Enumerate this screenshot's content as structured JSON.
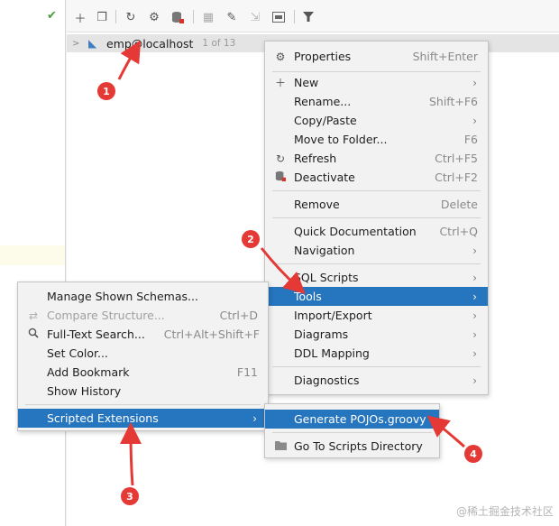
{
  "toolbar": {
    "icons": [
      "add-icon",
      "duplicate-icon",
      "refresh-icon",
      "properties-icon",
      "deactivate-icon",
      "table-icon",
      "edit-icon",
      "jump-icon",
      "query-console-icon",
      "filter-icon"
    ]
  },
  "tree": {
    "connection_label": "emp@localhost",
    "count_label": "1 of 13"
  },
  "context_menu": {
    "items": [
      {
        "label": "Properties",
        "shortcut": "Shift+Enter"
      },
      {
        "label": "New"
      },
      {
        "label": "Rename...",
        "shortcut": "Shift+F6"
      },
      {
        "label": "Copy/Paste"
      },
      {
        "label": "Move to Folder...",
        "shortcut": "F6"
      },
      {
        "label": "Refresh",
        "shortcut": "Ctrl+F5"
      },
      {
        "label": "Deactivate",
        "shortcut": "Ctrl+F2"
      },
      {
        "label": "Remove",
        "shortcut": "Delete"
      },
      {
        "label": "Quick Documentation",
        "shortcut": "Ctrl+Q"
      },
      {
        "label": "Navigation"
      },
      {
        "label": "SQL Scripts"
      },
      {
        "label": "Tools"
      },
      {
        "label": "Import/Export"
      },
      {
        "label": "Diagrams"
      },
      {
        "label": "DDL Mapping"
      },
      {
        "label": "Diagnostics"
      }
    ]
  },
  "tools_menu": {
    "items": [
      {
        "label": "Manage Shown Schemas..."
      },
      {
        "label": "Compare Structure...",
        "shortcut": "Ctrl+D"
      },
      {
        "label": "Full-Text Search...",
        "shortcut": "Ctrl+Alt+Shift+F"
      },
      {
        "label": "Set Color..."
      },
      {
        "label": "Add Bookmark",
        "shortcut": "F11"
      },
      {
        "label": "Show History"
      },
      {
        "label": "Scripted Extensions"
      }
    ]
  },
  "scripted_menu": {
    "items": [
      {
        "label": "Generate POJOs.groovy"
      },
      {
        "label": "Go To Scripts Directory"
      }
    ]
  },
  "annotations": {
    "badges": [
      "1",
      "2",
      "3",
      "4"
    ],
    "watermark": "@稀土掘金技术社区"
  },
  "colors": {
    "selection": "#2675bf",
    "annotation": "#e53935",
    "menu_bg": "#f2f2f2"
  }
}
